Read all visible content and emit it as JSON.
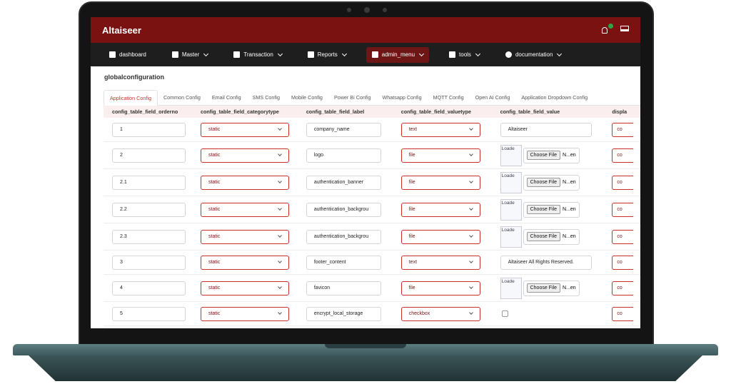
{
  "app": {
    "title": "Altaiseer"
  },
  "colors": {
    "brand": "#7b1212",
    "nav": "#1e1e1e",
    "accent": "#c9302c",
    "status_dot": "#27a844"
  },
  "topbar": {
    "icons": [
      "bell-icon",
      "laptop-icon"
    ]
  },
  "nav": [
    {
      "label": "dashboard",
      "icon": "grid-icon",
      "dropdown": false
    },
    {
      "label": "Master",
      "icon": "gear-icon",
      "dropdown": true
    },
    {
      "label": "Transaction",
      "icon": "gear-icon",
      "dropdown": true
    },
    {
      "label": "Reports",
      "icon": "folder-icon",
      "dropdown": true
    },
    {
      "label": "admin_menu",
      "icon": "sitemap-icon",
      "dropdown": true,
      "active": true
    },
    {
      "label": "tools",
      "icon": "tools-icon",
      "dropdown": true
    },
    {
      "label": "documentation",
      "icon": "info-icon",
      "dropdown": true
    }
  ],
  "page": {
    "title": "globalconfiguration"
  },
  "tabs": [
    "Application Config",
    "Common Config",
    "Email Config",
    "SMS Config",
    "Mobile Config",
    "Power Bi Config",
    "Whatsapp Config",
    "MQTT Config",
    "Open AI Config",
    "Application Dropdown Config"
  ],
  "table": {
    "headers": [
      "config_table_field_orderno",
      "config_table_field_categorytype",
      "config_table_field_label",
      "config_table_field_valuetype",
      "config_table_field_value",
      "displa"
    ],
    "rows": [
      {
        "orderno": "1",
        "category": "static",
        "label": "company_name",
        "valuetype": "text",
        "value": "Altaiseer",
        "kind": "text"
      },
      {
        "orderno": "2",
        "category": "static",
        "label": "logo",
        "valuetype": "file",
        "kind": "file"
      },
      {
        "orderno": "2.1",
        "category": "static",
        "label": "authentication_banner",
        "valuetype": "file",
        "kind": "file"
      },
      {
        "orderno": "2.2",
        "category": "static",
        "label": "authentication_backgrou",
        "valuetype": "file",
        "kind": "file"
      },
      {
        "orderno": "2.3",
        "category": "static",
        "label": "authentication_backgrou",
        "valuetype": "file",
        "kind": "file"
      },
      {
        "orderno": "3",
        "category": "static",
        "label": "footer_content",
        "valuetype": "text",
        "value": "Altaiseer All Rights Reserved.",
        "kind": "text"
      },
      {
        "orderno": "4",
        "category": "static",
        "label": "favicon",
        "valuetype": "file",
        "kind": "file"
      },
      {
        "orderno": "5",
        "category": "static",
        "label": "encrypt_local_storage",
        "valuetype": "checkbox",
        "kind": "checkbox"
      }
    ],
    "file_button_label": "Choose File",
    "file_status": "N...en",
    "image_alt": "Loade",
    "cut_col_text": "co"
  }
}
